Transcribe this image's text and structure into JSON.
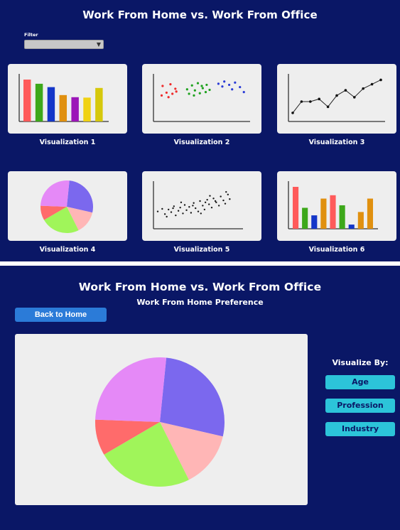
{
  "home": {
    "title": "Work From Home vs. Work From Office",
    "filter": {
      "label": "Filter",
      "value": ""
    },
    "visualizations": [
      {
        "label": "Visualization 1",
        "type": "bar"
      },
      {
        "label": "Visualization 2",
        "type": "scatter-clusters"
      },
      {
        "label": "Visualization 3",
        "type": "line"
      },
      {
        "label": "Visualization 4",
        "type": "pie"
      },
      {
        "label": "Visualization 5",
        "type": "scatter"
      },
      {
        "label": "Visualization 6",
        "type": "bar"
      }
    ]
  },
  "detail": {
    "title": "Work From Home vs. Work From Office",
    "subtitle": "Work From Home Preference",
    "back_label": "Back to Home",
    "visualize_by_label": "Visualize By:",
    "options": [
      "Age",
      "Profession",
      "Industry"
    ]
  },
  "colors": {
    "background": "#0a1766",
    "card": "#eeeeee",
    "back_button": "#2b7bd8",
    "option_button": "#2cc4d9"
  },
  "chart_data": [
    {
      "type": "bar",
      "chart": "visualization-1",
      "values": [
        10,
        9,
        8.2,
        6.3,
        5.8,
        5.7,
        8
      ],
      "colors": [
        "#ff5a5a",
        "#3da81a",
        "#1436c8",
        "#e0900f",
        "#9b16b8",
        "#f0d213",
        "#d6c80b"
      ]
    },
    {
      "type": "scatter",
      "chart": "visualization-2",
      "series": [
        {
          "color": "#ef2b2b",
          "points": [
            [
              1.5,
              6.6
            ],
            [
              2.3,
              6.9
            ],
            [
              2.8,
              6.1
            ],
            [
              1.9,
              5.4
            ],
            [
              2.5,
              5.2
            ],
            [
              2.1,
              4.6
            ],
            [
              1.4,
              4.9
            ],
            [
              2.9,
              5.6
            ]
          ]
        },
        {
          "color": "#1fa21f",
          "points": [
            [
              4.0,
              6.0
            ],
            [
              4.5,
              6.7
            ],
            [
              5.1,
              7.1
            ],
            [
              4.8,
              5.8
            ],
            [
              5.6,
              6.2
            ],
            [
              6.0,
              6.8
            ],
            [
              4.2,
              5.2
            ],
            [
              5.3,
              5.3
            ],
            [
              5.9,
              5.5
            ],
            [
              6.3,
              5.9
            ],
            [
              4.7,
              4.9
            ],
            [
              5.5,
              6.6
            ]
          ]
        },
        {
          "color": "#2a3bd6",
          "points": [
            [
              7.2,
              7.0
            ],
            [
              7.8,
              7.4
            ],
            [
              8.3,
              6.8
            ],
            [
              8.9,
              7.2
            ],
            [
              9.4,
              6.4
            ],
            [
              8.6,
              6.0
            ],
            [
              7.6,
              6.5
            ],
            [
              9.8,
              5.5
            ]
          ]
        }
      ]
    },
    {
      "type": "line",
      "chart": "visualization-3",
      "x": [
        1,
        2,
        3,
        4,
        5,
        6,
        7,
        8,
        9,
        10,
        11
      ],
      "values": [
        1.0,
        2.3,
        2.3,
        2.6,
        1.7,
        3.0,
        3.6,
        2.8,
        3.8,
        4.3,
        4.8
      ]
    },
    {
      "type": "pie",
      "chart": "visualization-4",
      "slices": [
        {
          "value": 27,
          "color": "#7b68ee"
        },
        {
          "value": 14,
          "color": "#ffb6b6"
        },
        {
          "value": 24,
          "color": "#a0f55a"
        },
        {
          "value": 9,
          "color": "#ff6b6b"
        },
        {
          "value": 26,
          "color": "#e589f7"
        }
      ]
    },
    {
      "type": "scatter",
      "chart": "visualization-5",
      "series": [
        {
          "color": "#1a1a1a",
          "points": [
            [
              1.0,
              3.0
            ],
            [
              1.5,
              3.4
            ],
            [
              1.8,
              2.6
            ],
            [
              2.2,
              3.3
            ],
            [
              2.5,
              2.9
            ],
            [
              2.8,
              3.8
            ],
            [
              3.0,
              2.4
            ],
            [
              3.3,
              3.1
            ],
            [
              3.5,
              3.6
            ],
            [
              3.8,
              2.7
            ],
            [
              4.0,
              4.0
            ],
            [
              4.2,
              3.2
            ],
            [
              4.5,
              3.7
            ],
            [
              4.7,
              2.8
            ],
            [
              5.0,
              4.3
            ],
            [
              5.2,
              3.5
            ],
            [
              5.5,
              3.0
            ],
            [
              5.7,
              4.6
            ],
            [
              6.0,
              3.9
            ],
            [
              6.2,
              3.3
            ],
            [
              6.5,
              4.8
            ],
            [
              6.7,
              4.1
            ],
            [
              7.0,
              3.6
            ],
            [
              7.2,
              5.0
            ],
            [
              7.5,
              4.4
            ],
            [
              7.8,
              3.9
            ],
            [
              8.0,
              5.3
            ],
            [
              8.3,
              4.7
            ],
            [
              8.5,
              4.2
            ],
            [
              8.8,
              5.6
            ],
            [
              9.0,
              4.9
            ],
            [
              2.0,
              2.2
            ],
            [
              3.6,
              4.4
            ],
            [
              5.8,
              2.7
            ],
            [
              6.8,
              5.4
            ],
            [
              4.9,
              3.9
            ],
            [
              7.4,
              4.6
            ],
            [
              2.7,
              3.5
            ],
            [
              6.3,
              4.4
            ],
            [
              8.6,
              6.0
            ]
          ]
        }
      ]
    },
    {
      "type": "bar",
      "chart": "visualization-6",
      "values": [
        10,
        5,
        3.2,
        7.2,
        8,
        5.6,
        1,
        4,
        7.2
      ],
      "colors": [
        "#ff5a5a",
        "#3da81a",
        "#1436c8",
        "#e0900f",
        "#ff5a5a",
        "#3da81a",
        "#1436c8",
        "#e0900f",
        "#e0900f"
      ]
    },
    {
      "type": "pie",
      "chart": "work-from-home-preference",
      "slices": [
        {
          "value": 27,
          "color": "#7b68ee"
        },
        {
          "value": 14,
          "color": "#ffb6b6"
        },
        {
          "value": 24,
          "color": "#a0f55a"
        },
        {
          "value": 9,
          "color": "#ff6b6b"
        },
        {
          "value": 26,
          "color": "#e589f7"
        }
      ]
    }
  ]
}
